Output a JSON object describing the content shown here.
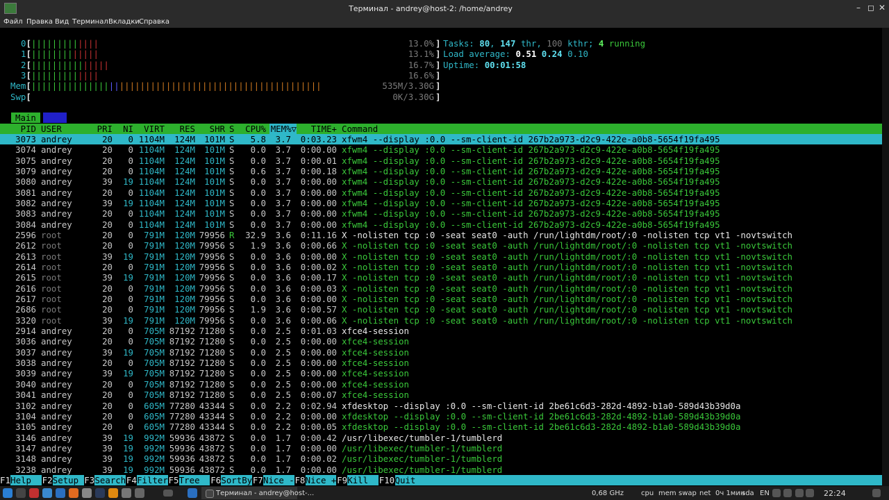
{
  "window": {
    "title": "Терминал - andrey@host-2: /home/andrey",
    "menu": [
      "Файл",
      "Правка",
      "Вид",
      "Терминал",
      "Вкладки",
      "Справка"
    ]
  },
  "htop": {
    "cpus": [
      {
        "label": "0",
        "green": "|||||||||",
        "red": "||||",
        "pct": "13.0%"
      },
      {
        "label": "1",
        "green": "||||||||",
        "red": "|||||",
        "pct": "13.1%"
      },
      {
        "label": "2",
        "green": "||||||||||",
        "red": "|||||",
        "pct": "16.7%"
      },
      {
        "label": "3",
        "green": "|||||||||",
        "red": "||||",
        "pct": "16.6%"
      }
    ],
    "mem": {
      "label": "Mem",
      "green": "|||||||||||||||",
      "blue": "||",
      "orange": "|||||||||||||||||||||||||||||||||||||||",
      "value": "535M/3.30G"
    },
    "swp": {
      "label": "Swp",
      "value": "0K/3.30G"
    },
    "tasks": {
      "label": "Tasks:",
      "count": "80",
      "thr": "147",
      "thr_label": "thr,",
      "kthr": "100",
      "kthr_label": "kthr;",
      "running": "4",
      "running_label": "running"
    },
    "load": {
      "label": "Load average:",
      "v1": "0.51",
      "v5": "0.24",
      "v15": "0.10"
    },
    "uptime": {
      "label": "Uptime:",
      "value": "00:01:58"
    },
    "tabs": {
      "main": "Main",
      "io": "I/O"
    },
    "columns": [
      "PID",
      "USER",
      "PRI",
      "NI",
      "VIRT",
      "RES",
      "SHR",
      "S",
      "CPU%",
      "MEM%▽",
      "TIME+",
      "Command"
    ],
    "rows": [
      {
        "pid": "3073",
        "user": "andrey",
        "pri": "20",
        "ni": "0",
        "virt": "1104M",
        "res": "124M",
        "shr": "101M",
        "s": "S",
        "cpu": "5.8",
        "mem": "3.7",
        "time": "0:03.23",
        "cmd": "xfwm4 --display :0.0 --sm-client-id 267b2a973-d2c9-422e-a0b8-5654f19fa495",
        "thread": false,
        "sel": true
      },
      {
        "pid": "3074",
        "user": "andrey",
        "pri": "20",
        "ni": "0",
        "virt": "1104M",
        "res": "124M",
        "shr": "101M",
        "s": "S",
        "cpu": "0.0",
        "mem": "3.7",
        "time": "0:00.00",
        "cmd": "xfwm4 --display :0.0 --sm-client-id 267b2a973-d2c9-422e-a0b8-5654f19fa495",
        "thread": true
      },
      {
        "pid": "3075",
        "user": "andrey",
        "pri": "20",
        "ni": "0",
        "virt": "1104M",
        "res": "124M",
        "shr": "101M",
        "s": "S",
        "cpu": "0.0",
        "mem": "3.7",
        "time": "0:00.01",
        "cmd": "xfwm4 --display :0.0 --sm-client-id 267b2a973-d2c9-422e-a0b8-5654f19fa495",
        "thread": true
      },
      {
        "pid": "3079",
        "user": "andrey",
        "pri": "20",
        "ni": "0",
        "virt": "1104M",
        "res": "124M",
        "shr": "101M",
        "s": "S",
        "cpu": "0.6",
        "mem": "3.7",
        "time": "0:00.18",
        "cmd": "xfwm4 --display :0.0 --sm-client-id 267b2a973-d2c9-422e-a0b8-5654f19fa495",
        "thread": true
      },
      {
        "pid": "3080",
        "user": "andrey",
        "pri": "39",
        "ni": "19",
        "virt": "1104M",
        "res": "124M",
        "shr": "101M",
        "s": "S",
        "cpu": "0.0",
        "mem": "3.7",
        "time": "0:00.00",
        "cmd": "xfwm4 --display :0.0 --sm-client-id 267b2a973-d2c9-422e-a0b8-5654f19fa495",
        "thread": true
      },
      {
        "pid": "3081",
        "user": "andrey",
        "pri": "20",
        "ni": "0",
        "virt": "1104M",
        "res": "124M",
        "shr": "101M",
        "s": "S",
        "cpu": "0.0",
        "mem": "3.7",
        "time": "0:00.00",
        "cmd": "xfwm4 --display :0.0 --sm-client-id 267b2a973-d2c9-422e-a0b8-5654f19fa495",
        "thread": true
      },
      {
        "pid": "3082",
        "user": "andrey",
        "pri": "39",
        "ni": "19",
        "virt": "1104M",
        "res": "124M",
        "shr": "101M",
        "s": "S",
        "cpu": "0.0",
        "mem": "3.7",
        "time": "0:00.00",
        "cmd": "xfwm4 --display :0.0 --sm-client-id 267b2a973-d2c9-422e-a0b8-5654f19fa495",
        "thread": true
      },
      {
        "pid": "3083",
        "user": "andrey",
        "pri": "20",
        "ni": "0",
        "virt": "1104M",
        "res": "124M",
        "shr": "101M",
        "s": "S",
        "cpu": "0.0",
        "mem": "3.7",
        "time": "0:00.00",
        "cmd": "xfwm4 --display :0.0 --sm-client-id 267b2a973-d2c9-422e-a0b8-5654f19fa495",
        "thread": true
      },
      {
        "pid": "3084",
        "user": "andrey",
        "pri": "20",
        "ni": "0",
        "virt": "1104M",
        "res": "124M",
        "shr": "101M",
        "s": "S",
        "cpu": "0.0",
        "mem": "3.7",
        "time": "0:00.00",
        "cmd": "xfwm4 --display :0.0 --sm-client-id 267b2a973-d2c9-422e-a0b8-5654f19fa495",
        "thread": true
      },
      {
        "pid": "2596",
        "user": "root",
        "pri": "20",
        "ni": "0",
        "virt": "791M",
        "res": "120M",
        "shr": "79956",
        "s": "R",
        "cpu": "32.9",
        "mem": "3.6",
        "time": "0:11.16",
        "cmd": "X -nolisten tcp :0 -seat seat0 -auth /run/lightdm/root/:0 -nolisten tcp vt1 -novtswitch",
        "thread": false
      },
      {
        "pid": "2612",
        "user": "root",
        "pri": "20",
        "ni": "0",
        "virt": "791M",
        "res": "120M",
        "shr": "79956",
        "s": "S",
        "cpu": "1.9",
        "mem": "3.6",
        "time": "0:00.66",
        "cmd": "X -nolisten tcp :0 -seat seat0 -auth /run/lightdm/root/:0 -nolisten tcp vt1 -novtswitch",
        "thread": true
      },
      {
        "pid": "2613",
        "user": "root",
        "pri": "39",
        "ni": "19",
        "virt": "791M",
        "res": "120M",
        "shr": "79956",
        "s": "S",
        "cpu": "0.0",
        "mem": "3.6",
        "time": "0:00.00",
        "cmd": "X -nolisten tcp :0 -seat seat0 -auth /run/lightdm/root/:0 -nolisten tcp vt1 -novtswitch",
        "thread": true
      },
      {
        "pid": "2614",
        "user": "root",
        "pri": "20",
        "ni": "0",
        "virt": "791M",
        "res": "120M",
        "shr": "79956",
        "s": "S",
        "cpu": "0.0",
        "mem": "3.6",
        "time": "0:00.02",
        "cmd": "X -nolisten tcp :0 -seat seat0 -auth /run/lightdm/root/:0 -nolisten tcp vt1 -novtswitch",
        "thread": true
      },
      {
        "pid": "2615",
        "user": "root",
        "pri": "39",
        "ni": "19",
        "virt": "791M",
        "res": "120M",
        "shr": "79956",
        "s": "S",
        "cpu": "0.0",
        "mem": "3.6",
        "time": "0:00.17",
        "cmd": "X -nolisten tcp :0 -seat seat0 -auth /run/lightdm/root/:0 -nolisten tcp vt1 -novtswitch",
        "thread": true
      },
      {
        "pid": "2616",
        "user": "root",
        "pri": "20",
        "ni": "0",
        "virt": "791M",
        "res": "120M",
        "shr": "79956",
        "s": "S",
        "cpu": "0.0",
        "mem": "3.6",
        "time": "0:00.03",
        "cmd": "X -nolisten tcp :0 -seat seat0 -auth /run/lightdm/root/:0 -nolisten tcp vt1 -novtswitch",
        "thread": true
      },
      {
        "pid": "2617",
        "user": "root",
        "pri": "20",
        "ni": "0",
        "virt": "791M",
        "res": "120M",
        "shr": "79956",
        "s": "S",
        "cpu": "0.0",
        "mem": "3.6",
        "time": "0:00.00",
        "cmd": "X -nolisten tcp :0 -seat seat0 -auth /run/lightdm/root/:0 -nolisten tcp vt1 -novtswitch",
        "thread": true
      },
      {
        "pid": "2686",
        "user": "root",
        "pri": "20",
        "ni": "0",
        "virt": "791M",
        "res": "120M",
        "shr": "79956",
        "s": "S",
        "cpu": "1.9",
        "mem": "3.6",
        "time": "0:00.57",
        "cmd": "X -nolisten tcp :0 -seat seat0 -auth /run/lightdm/root/:0 -nolisten tcp vt1 -novtswitch",
        "thread": true
      },
      {
        "pid": "3320",
        "user": "root",
        "pri": "39",
        "ni": "19",
        "virt": "791M",
        "res": "120M",
        "shr": "79956",
        "s": "S",
        "cpu": "0.0",
        "mem": "3.6",
        "time": "0:00.06",
        "cmd": "X -nolisten tcp :0 -seat seat0 -auth /run/lightdm/root/:0 -nolisten tcp vt1 -novtswitch",
        "thread": true
      },
      {
        "pid": "2914",
        "user": "andrey",
        "pri": "20",
        "ni": "0",
        "virt": "705M",
        "res": "87192",
        "shr": "71280",
        "s": "S",
        "cpu": "0.0",
        "mem": "2.5",
        "time": "0:01.03",
        "cmd": "xfce4-session",
        "thread": false
      },
      {
        "pid": "3036",
        "user": "andrey",
        "pri": "20",
        "ni": "0",
        "virt": "705M",
        "res": "87192",
        "shr": "71280",
        "s": "S",
        "cpu": "0.0",
        "mem": "2.5",
        "time": "0:00.00",
        "cmd": "xfce4-session",
        "thread": true
      },
      {
        "pid": "3037",
        "user": "andrey",
        "pri": "39",
        "ni": "19",
        "virt": "705M",
        "res": "87192",
        "shr": "71280",
        "s": "S",
        "cpu": "0.0",
        "mem": "2.5",
        "time": "0:00.00",
        "cmd": "xfce4-session",
        "thread": true
      },
      {
        "pid": "3038",
        "user": "andrey",
        "pri": "20",
        "ni": "0",
        "virt": "705M",
        "res": "87192",
        "shr": "71280",
        "s": "S",
        "cpu": "0.0",
        "mem": "2.5",
        "time": "0:00.00",
        "cmd": "xfce4-session",
        "thread": true
      },
      {
        "pid": "3039",
        "user": "andrey",
        "pri": "39",
        "ni": "19",
        "virt": "705M",
        "res": "87192",
        "shr": "71280",
        "s": "S",
        "cpu": "0.0",
        "mem": "2.5",
        "time": "0:00.00",
        "cmd": "xfce4-session",
        "thread": true
      },
      {
        "pid": "3040",
        "user": "andrey",
        "pri": "20",
        "ni": "0",
        "virt": "705M",
        "res": "87192",
        "shr": "71280",
        "s": "S",
        "cpu": "0.0",
        "mem": "2.5",
        "time": "0:00.00",
        "cmd": "xfce4-session",
        "thread": true
      },
      {
        "pid": "3041",
        "user": "andrey",
        "pri": "20",
        "ni": "0",
        "virt": "705M",
        "res": "87192",
        "shr": "71280",
        "s": "S",
        "cpu": "0.0",
        "mem": "2.5",
        "time": "0:00.07",
        "cmd": "xfce4-session",
        "thread": true
      },
      {
        "pid": "3102",
        "user": "andrey",
        "pri": "20",
        "ni": "0",
        "virt": "605M",
        "res": "77280",
        "shr": "43344",
        "s": "S",
        "cpu": "0.0",
        "mem": "2.2",
        "time": "0:02.94",
        "cmd": "xfdesktop --display :0.0 --sm-client-id 2be61c6d3-282d-4892-b1a0-589d43b39d0a",
        "thread": false
      },
      {
        "pid": "3104",
        "user": "andrey",
        "pri": "20",
        "ni": "0",
        "virt": "605M",
        "res": "77280",
        "shr": "43344",
        "s": "S",
        "cpu": "0.0",
        "mem": "2.2",
        "time": "0:00.00",
        "cmd": "xfdesktop --display :0.0 --sm-client-id 2be61c6d3-282d-4892-b1a0-589d43b39d0a",
        "thread": true
      },
      {
        "pid": "3105",
        "user": "andrey",
        "pri": "20",
        "ni": "0",
        "virt": "605M",
        "res": "77280",
        "shr": "43344",
        "s": "S",
        "cpu": "0.0",
        "mem": "2.2",
        "time": "0:00.05",
        "cmd": "xfdesktop --display :0.0 --sm-client-id 2be61c6d3-282d-4892-b1a0-589d43b39d0a",
        "thread": true
      },
      {
        "pid": "3146",
        "user": "andrey",
        "pri": "39",
        "ni": "19",
        "virt": "992M",
        "res": "59936",
        "shr": "43872",
        "s": "S",
        "cpu": "0.0",
        "mem": "1.7",
        "time": "0:00.42",
        "cmd": "/usr/libexec/tumbler-1/tumblerd",
        "thread": false
      },
      {
        "pid": "3147",
        "user": "andrey",
        "pri": "39",
        "ni": "19",
        "virt": "992M",
        "res": "59936",
        "shr": "43872",
        "s": "S",
        "cpu": "0.0",
        "mem": "1.7",
        "time": "0:00.00",
        "cmd": "/usr/libexec/tumbler-1/tumblerd",
        "thread": true
      },
      {
        "pid": "3148",
        "user": "andrey",
        "pri": "39",
        "ni": "19",
        "virt": "992M",
        "res": "59936",
        "shr": "43872",
        "s": "S",
        "cpu": "0.0",
        "mem": "1.7",
        "time": "0:00.02",
        "cmd": "/usr/libexec/tumbler-1/tumblerd",
        "thread": true
      },
      {
        "pid": "3238",
        "user": "andrey",
        "pri": "39",
        "ni": "19",
        "virt": "992M",
        "res": "59936",
        "shr": "43872",
        "s": "S",
        "cpu": "0.0",
        "mem": "1.7",
        "time": "0:00.00",
        "cmd": "/usr/libexec/tumbler-1/tumblerd",
        "thread": true
      }
    ],
    "fkeys": [
      {
        "key": "F1",
        "label": "Help  "
      },
      {
        "key": "F2",
        "label": "Setup "
      },
      {
        "key": "F3",
        "label": "Search"
      },
      {
        "key": "F4",
        "label": "Filter"
      },
      {
        "key": "F5",
        "label": "Tree  "
      },
      {
        "key": "F6",
        "label": "SortBy"
      },
      {
        "key": "F7",
        "label": "Nice -"
      },
      {
        "key": "F8",
        "label": "Nice +"
      },
      {
        "key": "F9",
        "label": "Kill  "
      },
      {
        "key": "F10",
        "label": "Quit"
      }
    ]
  },
  "taskbar": {
    "task_title": "Терминал - andrey@host-...",
    "cpu_freq": "0,68 GHz",
    "monitors": [
      "cpu",
      "mem",
      "swap",
      "net"
    ],
    "uptime": "0ч 1мин",
    "disk": "sda",
    "lang": "EN",
    "clock": "22:24",
    "launcher_icons": [
      "menu-icon",
      "terminal-icon",
      "taskmanager-icon",
      "files-icon",
      "browser-icon",
      "firefox-icon",
      "settings-icon",
      "steam-icon",
      "vlc-icon",
      "archive-icon",
      "calculator-icon"
    ],
    "tray_icons": [
      "keyboard-icon",
      "battery-icon",
      "volume-icon",
      "notifications-icon",
      "power-icon"
    ]
  },
  "colors": {
    "header_green": "#2db02d",
    "selection_cyan": "#2fb8c8",
    "io_tab_blue": "#2020c8"
  }
}
